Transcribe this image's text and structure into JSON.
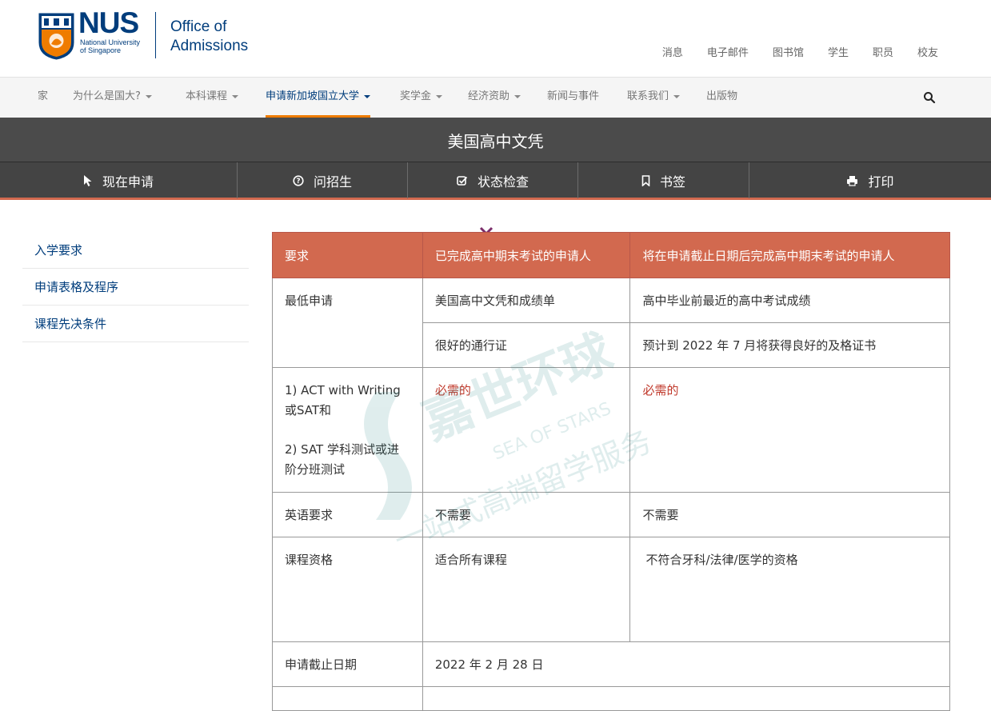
{
  "header": {
    "logo_text": "NUS",
    "logo_sub_line1": "National University",
    "logo_sub_line2": "of Singapore",
    "office_line1": "Office of",
    "office_line2": "Admissions",
    "utility_links": [
      "消息",
      "电子邮件",
      "图书馆",
      "学生",
      "职员",
      "校友"
    ]
  },
  "nav": {
    "items": [
      {
        "label": "家",
        "dropdown": false
      },
      {
        "label": "为什么是国大?",
        "dropdown": true
      },
      {
        "label": "本科课程",
        "dropdown": true
      },
      {
        "label": "申请新加坡国立大学",
        "dropdown": true,
        "active": true
      },
      {
        "label": "奖学金",
        "dropdown": true
      },
      {
        "label": "经济资助",
        "dropdown": true
      },
      {
        "label": "新闻与事件",
        "dropdown": false
      },
      {
        "label": "联系我们",
        "dropdown": true
      },
      {
        "label": "出版物",
        "dropdown": false
      }
    ],
    "search_icon": "search-icon"
  },
  "title": "美国高中文凭",
  "actions": [
    {
      "label": "现在申请",
      "icon": "cursor-icon"
    },
    {
      "label": "问招生",
      "icon": "question-icon"
    },
    {
      "label": "状态检查",
      "icon": "checkbox-icon"
    },
    {
      "label": "书签",
      "icon": "bookmark-icon"
    },
    {
      "label": "打印",
      "icon": "print-icon"
    }
  ],
  "sidebar": {
    "links": [
      "入学要求",
      "申请表格及程序",
      "课程先决条件"
    ]
  },
  "table": {
    "headers": [
      "要求",
      "已完成高中期末考试的申请人",
      "将在申请截止日期后完成高中期末考试的申请人"
    ],
    "min_app_label": "最低申请",
    "min_app_row1": [
      "美国高中文凭和成绩单",
      "高中毕业前最近的高中考试成绩"
    ],
    "min_app_row2": [
      "很好的通行证",
      "预计到 2022 年 7 月将获得良好的及格证书"
    ],
    "test_label_1": "1) ACT with Writing或SAT和",
    "test_label_2": "2) SAT 学科测试或进阶分班测试",
    "test_values": [
      "必需的",
      "必需的"
    ],
    "english_label": "英语要求",
    "english_values": [
      "不需要",
      "不需要"
    ],
    "course_label": "课程资格",
    "course_values": [
      "适合所有课程",
      "不符合牙科/法律/医学的资格"
    ],
    "deadline_label": "申请截止日期",
    "deadline_value": "2022 年 2 月 28 日"
  },
  "watermark": {
    "brand": "嘉世环球",
    "english": "SEA OF STARS",
    "tagline": "一站式高端留学服务"
  },
  "colors": {
    "nus_blue": "#003d7c",
    "nus_orange": "#ef7c00",
    "table_header": "#d2694f",
    "titlebar": "#4b4b4b",
    "required_red": "#c0392b"
  }
}
